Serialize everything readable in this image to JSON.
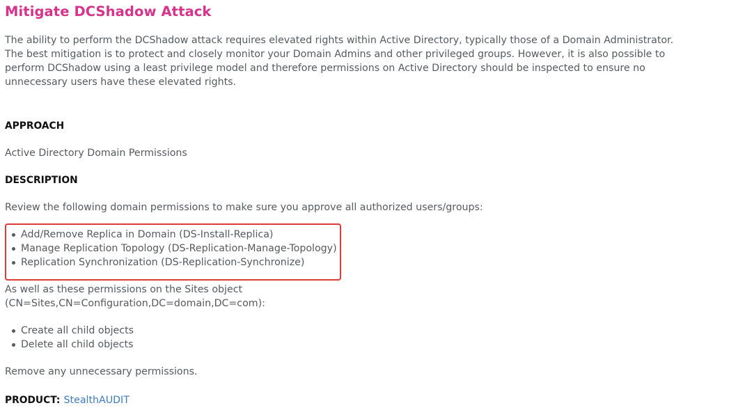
{
  "title": "Mitigate DCShadow Attack",
  "intro_lines": [
    "The ability to perform the DCShadow attack requires elevated rights within Active Directory, typically those of a Domain Administrator.",
    "The best mitigation is to protect and closely monitor your Domain Admins and other privileged groups. However, it is also possible to",
    "perform DCShadow using a least privilege model and therefore permissions on Active Directory should be inspected to ensure no",
    "unnecessary users have these elevated rights."
  ],
  "approach": {
    "heading": "APPROACH",
    "text": "Active Directory Domain Permissions"
  },
  "description": {
    "heading": "DESCRIPTION",
    "text": "Review the following domain permissions to make sure you approve all authorized users/groups:",
    "domain_permissions": [
      "Add/Remove Replica in Domain (DS-Install-Replica)",
      "Manage Replication Topology (DS-Replication-Manage-Topology)",
      "Replication Synchronization (DS-Replication-Synchronize)"
    ],
    "sites_intro_lines": [
      "As well as these permissions on the Sites object",
      "(CN=Sites,CN=Configuration,DC=domain,DC=com):"
    ],
    "sites_permissions": [
      "Create all child objects",
      "Delete all child objects"
    ],
    "closing": "Remove any unnecessary permissions."
  },
  "product": {
    "label": "PRODUCT:",
    "link_text": "StealthAUDIT"
  },
  "colors": {
    "title": "#d6338c",
    "highlight_border": "#e03a3a",
    "link": "#3f7bbf"
  }
}
